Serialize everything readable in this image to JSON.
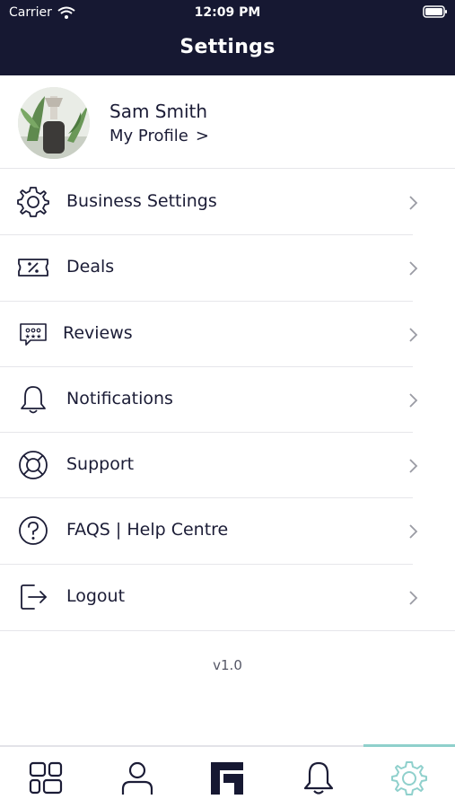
{
  "status_bar": {
    "carrier": "Carrier",
    "time": "12:09 PM"
  },
  "header": {
    "title": "Settings"
  },
  "profile": {
    "name": "Sam Smith",
    "link_label": "My Profile",
    "link_chevron": ">"
  },
  "menu": {
    "items": [
      {
        "label": "Business Settings",
        "icon": "gear-icon"
      },
      {
        "label": "Deals",
        "icon": "ticket-percent-icon"
      },
      {
        "label": "Reviews",
        "icon": "reviews-chat-stars-icon"
      },
      {
        "label": "Notifications",
        "icon": "bell-icon"
      },
      {
        "label": "Support",
        "icon": "lifebuoy-icon"
      },
      {
        "label": "FAQS | Help Centre",
        "icon": "question-circle-icon"
      },
      {
        "label": "Logout",
        "icon": "logout-icon"
      }
    ]
  },
  "version": "v1.0",
  "tabbar": {
    "tabs": [
      "dashboard-icon",
      "person-icon",
      "brand-logo-icon",
      "bell-icon",
      "gear-icon"
    ],
    "active_index": 4
  },
  "colors": {
    "header_bg": "#161832",
    "text": "#1b1c36",
    "accent": "#8fd0cc"
  }
}
